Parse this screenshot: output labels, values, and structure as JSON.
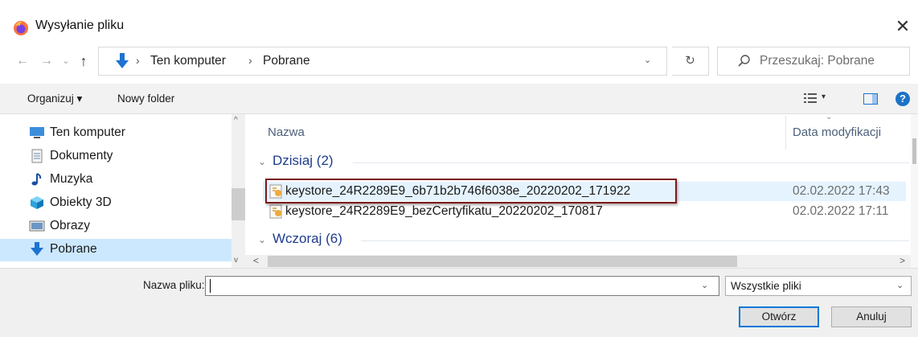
{
  "window": {
    "title": "Wysyłanie pliku",
    "close_glyph": "✕"
  },
  "address": {
    "back_glyph": "←",
    "forward_glyph": "→",
    "history_glyph": "⌄",
    "up_glyph": "↑",
    "crumbs": [
      "Ten komputer",
      "Pobrane"
    ],
    "separator": "›",
    "dropdown_glyph": "⌄",
    "refresh_glyph": "↻",
    "search_placeholder": "Przeszukaj: Pobrane"
  },
  "toolbar": {
    "organize_label": "Organizuj ▾",
    "new_folder_label": "Nowy folder",
    "view_dropdown_glyph": "▾",
    "help_glyph": "?"
  },
  "nav_pane": {
    "items": [
      {
        "label": "Ten komputer",
        "icon": "computer-icon"
      },
      {
        "label": "Dokumenty",
        "icon": "document-icon"
      },
      {
        "label": "Muzyka",
        "icon": "music-icon"
      },
      {
        "label": "Obiekty 3D",
        "icon": "3d-objects-icon"
      },
      {
        "label": "Obrazy",
        "icon": "pictures-icon"
      },
      {
        "label": "Pobrane",
        "icon": "downloads-icon",
        "selected": true
      }
    ],
    "scroll_up_glyph": "^",
    "scroll_down_glyph": "v"
  },
  "file_list": {
    "columns": {
      "name": "Nazwa",
      "date": "Data modyfikacji"
    },
    "sort_glyph": "⌄",
    "groups": [
      {
        "label": "Dzisiaj (2)",
        "files": [
          {
            "name": "keystore_24R2289E9_6b71b2b746f6038e_20220202_171922",
            "date": "02.02.2022 17:43",
            "selected": true
          },
          {
            "name": "keystore_24R2289E9_bezCertyfikatu_20220202_170817",
            "date": "02.02.2022 17:11"
          }
        ]
      },
      {
        "label": "Wczoraj (6)",
        "files": []
      }
    ],
    "hscroll_left_glyph": "<",
    "hscroll_right_glyph": ">"
  },
  "bottom": {
    "filename_label": "Nazwa pliku:",
    "filename_value": "",
    "dropdown_glyph": "⌄",
    "filter_value": "Wszystkie pliki",
    "open_label": "Otwórz",
    "cancel_label": "Anuluj"
  },
  "colors": {
    "accent": "#0078d7",
    "selection": "#cce8ff",
    "highlight_box": "#7b1a1a",
    "group_header": "#1e3c8c"
  }
}
